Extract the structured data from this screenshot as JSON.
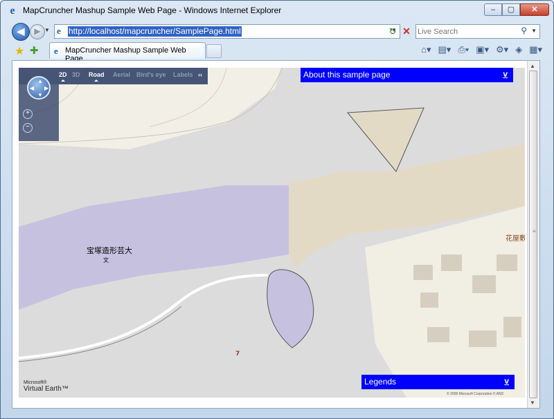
{
  "window": {
    "title": "MapCruncher Mashup Sample Web Page - Windows Internet Explorer",
    "min_label": "–",
    "max_label": "▢",
    "close_label": "✕"
  },
  "navbar": {
    "url": "http://localhost/mapcruncher/SamplePage.html",
    "search_placeholder": "Live Search"
  },
  "tabbar": {
    "tab_label": "MapCruncher Mashup Sample Web Page"
  },
  "map_controls": {
    "view_2d": "2D",
    "view_3d": "3D",
    "road": "Road",
    "aerial": "Aerial",
    "birdseye": "Bird's eye",
    "labels": "Labels",
    "collapse": "‹‹"
  },
  "panels": {
    "about_label": "About this sample page",
    "about_toggle": "v",
    "legends_label": "Legends",
    "legends_toggle": "v"
  },
  "map": {
    "campus_name": "宝塚造形芸大",
    "campus_symbol": "文",
    "town_label": "花屋敷",
    "route_number": "7",
    "logo_ms": "Microsoft®",
    "logo_ve": "Virtual Earth™",
    "copyright": "© 2008 Microsoft Corporation   © AND"
  }
}
